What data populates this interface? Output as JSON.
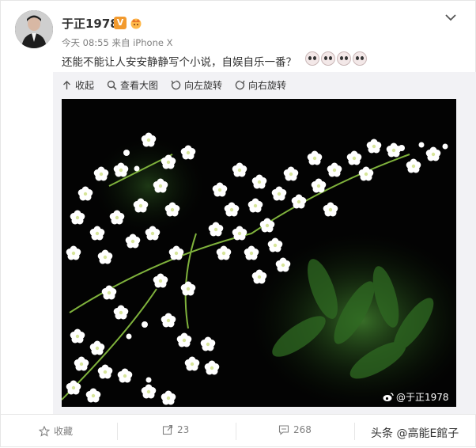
{
  "post": {
    "author": "于正1978",
    "verified_badge": "V",
    "time": "今天 08:55",
    "source_prefix": "来自",
    "source": "iPhone X",
    "text": "还能不能让人安安静静写个小说，自娱自乐一番？",
    "emoji_count": 4
  },
  "media_toolbar": {
    "collapse": "收起",
    "view_large": "查看大图",
    "rotate_left": "向左旋转",
    "rotate_right": "向右旋转"
  },
  "photo": {
    "watermark": "@于正1978",
    "subject": "white flowers"
  },
  "footer": {
    "favorite": "收藏",
    "reposts": "23",
    "comments": "268",
    "source_watermark": "头条 @高能E館子"
  },
  "colors": {
    "badge": "#f29a2e",
    "meta": "#808080",
    "panel": "#f2f2f5"
  }
}
